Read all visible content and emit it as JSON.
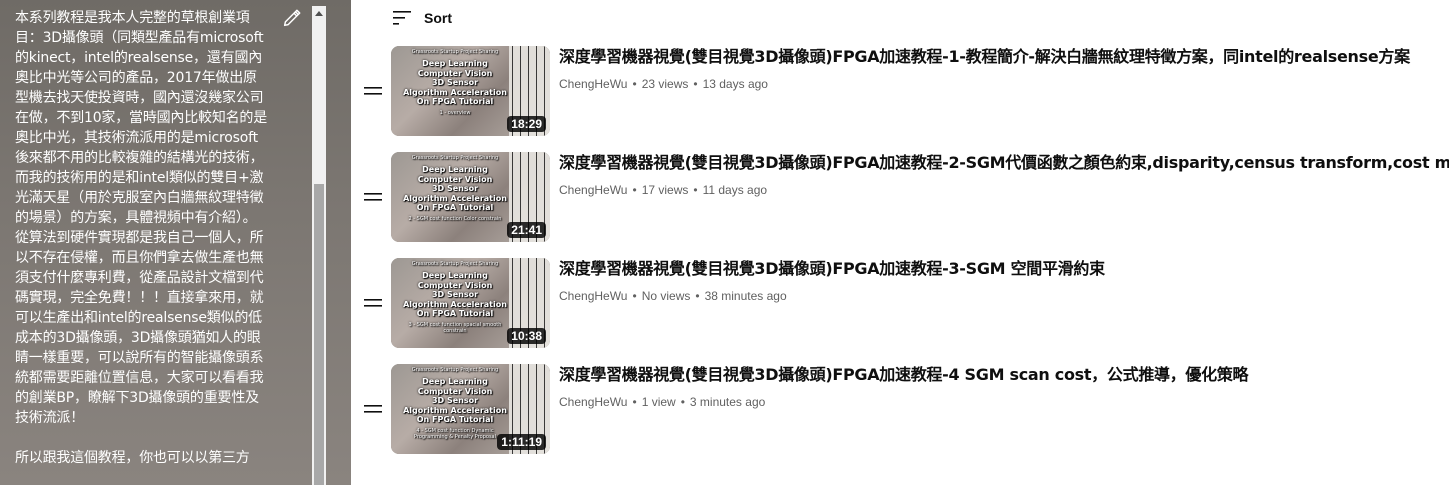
{
  "description": {
    "text": "本系列教程是我本人完整的草根創業項目：3D攝像頭（同類型產品有microsoft的kinect，intel的realsense，還有國內奧比中光等公司的產品，2017年做出原型機去找天使投資時，國內還沒幾家公司在做，不到10家，當時國內比較知名的是奧比中光，其技術流派用的是microsoft後來都不用的比較複雜的結構光的技術，而我的技術用的是和intel類似的雙目+激光滿天星（用於克服室內白牆無紋理特徵的場景）的方案，具體視頻中有介紹）。從算法到硬件實現都是我自己一個人，所以不存在侵權，而且你們拿去做生產也無須支付什麼專利費，從產品設計文檔到代碼實現，完全免費！！！直接拿來用，就可以生產出和intel的realsense類似的低成本的3D攝像頭，3D攝像頭猶如人的眼睛一樣重要，可以說所有的智能攝像頭系統都需要距離位置信息，大家可以看看我的創業BP，瞭解下3D攝像頭的重要性及技術流派！\n\n所以跟我這個教程，你也可以以第三方"
  },
  "sort": {
    "label": "Sort"
  },
  "thumbnail_common": {
    "top": "Grassroots Startup Project Sharing",
    "lines": [
      "Deep Learning",
      "Computer Vision",
      "3D Sensor",
      "Algorithm Acceleration",
      "On FPGA Tutorial"
    ]
  },
  "videos": [
    {
      "title": "深度學習機器視覺(雙目視覺3D攝像頭)FPGA加速教程-1-教程簡介-解決白牆無紋理特徵方案，同intel的realsense方案",
      "channel": "ChengHeWu",
      "views": "23 views",
      "age": "13 days ago",
      "duration": "18:29",
      "thumb_sub": "1 - overview"
    },
    {
      "title": "深度學習機器視覺(雙目視覺3D攝像頭)FPGA加速教程-2-SGM代價函數之顏色約束,disparity,census transform,cost matching",
      "channel": "ChengHeWu",
      "views": "17 views",
      "age": "11 days ago",
      "duration": "21:41",
      "thumb_sub": "2 - SGM cost function Color constrain"
    },
    {
      "title": "深度學習機器視覺(雙目視覺3D攝像頭)FPGA加速教程-3-SGM 空間平滑約束",
      "channel": "ChengHeWu",
      "views": "No views",
      "age": "38 minutes ago",
      "duration": "10:38",
      "thumb_sub": "3 - SGM cost function spacial smooth constrain"
    },
    {
      "title": "深度學習機器視覺(雙目視覺3D攝像頭)FPGA加速教程-4 SGM scan cost，公式推導，優化策略",
      "channel": "ChengHeWu",
      "views": "1 view",
      "age": "3 minutes ago",
      "duration": "1:11:19",
      "thumb_sub": "4 - SGM cost function Dynamic Programming & Penalty Proposal"
    }
  ],
  "icons": {
    "edit": "pencil-icon",
    "sort": "sort-icon",
    "drag": "drag-handle-icon",
    "scroll_up": "scroll-up-arrow-icon"
  },
  "colors": {
    "panel": "#7b7671",
    "title": "#0f0f0f",
    "meta": "#606060",
    "duration_bg": "#000000"
  }
}
